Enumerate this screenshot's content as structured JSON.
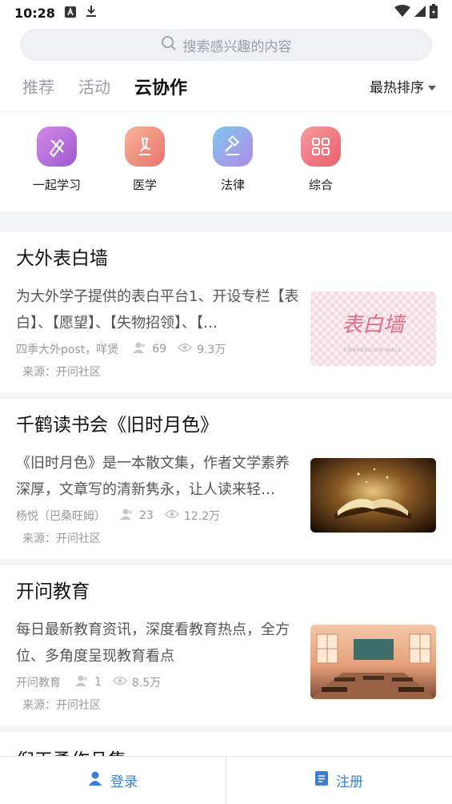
{
  "status": {
    "time": "10:28"
  },
  "search": {
    "placeholder": "搜索感兴趣的内容"
  },
  "tabs": [
    {
      "label": "推荐"
    },
    {
      "label": "活动"
    },
    {
      "label": "云协作",
      "active": true
    }
  ],
  "sort": {
    "label": "最热排序"
  },
  "categories": [
    {
      "label": "一起学习",
      "icon": "pencil-ruler-icon",
      "color": "#b46cd6"
    },
    {
      "label": "医学",
      "icon": "microscope-icon",
      "color": "#f0957a"
    },
    {
      "label": "法律",
      "icon": "gavel-icon",
      "color": "#8a9de8"
    },
    {
      "label": "综合",
      "icon": "grid-icon",
      "color": "#f07a85"
    }
  ],
  "cards": [
    {
      "title": "大外表白墙",
      "desc": "为大外学子提供的表白平台1、开设专栏【表白】、【愿望】、【失物招领】、【…",
      "author": "四季大外post，咩煲",
      "members": "69",
      "views": "9.3万",
      "source": "来源：开问社区",
      "thumb_text": "表白墙",
      "thumb_sub": "CONFESSION WALL"
    },
    {
      "title": "千鹤读书会《旧时月色》",
      "desc": "《旧时月色》是一本散文集，作者文学素养深厚，文章写的清新隽永，让人读来轻…",
      "author": "杨悦（巴桑旺姆）",
      "members": "23",
      "views": "12.2万",
      "source": "来源：开问社区"
    },
    {
      "title": "开问教育",
      "desc": "每日最新教育资讯，深度看教育热点，全方位、多角度呈现教育看点",
      "author": "开问教育",
      "members": "1",
      "views": "8.5万",
      "source": "来源：开问社区"
    }
  ],
  "partial_card": {
    "title": "倪天勇作品集"
  },
  "bottom": {
    "login": "登录",
    "register": "注册"
  }
}
